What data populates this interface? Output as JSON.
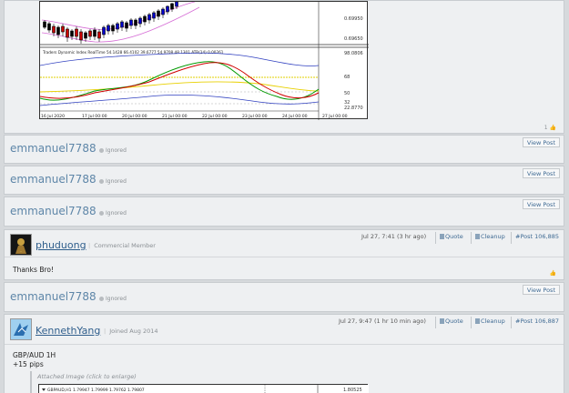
{
  "top_chart": {
    "indicator_header": "Traders Dynamic Index RealTime 54.1428 66.4102 39.6777 54.9708 48.1301  ATR(14) 0.00261",
    "price_ticks": [
      "0.69950",
      "0.69650"
    ],
    "indicator_ticks": [
      "98.0806",
      "68",
      "50",
      "32",
      "22.8770"
    ],
    "date_labels": [
      "16 Jul 2020",
      "17 Jul 00:00",
      "20 Jul 00:00",
      "21 Jul 00:00",
      "22 Jul 00:00",
      "23 Jul 00:00",
      "24 Jul 00:00",
      "27 Jul 00:00"
    ],
    "like_count": "1"
  },
  "ignored_posts": [
    {
      "username": "emmanuel7788",
      "status": "Ignored",
      "action": "View Post"
    },
    {
      "username": "emmanuel7788",
      "status": "Ignored",
      "action": "View Post"
    },
    {
      "username": "emmanuel7788",
      "status": "Ignored",
      "action": "View Post"
    },
    {
      "username": "emmanuel7788",
      "status": "Ignored",
      "action": "View Post"
    }
  ],
  "post_phuduong": {
    "username": "phuduong",
    "role": "Commercial Member",
    "timestamp": "Jul 27, 7:41 (3 hr ago)",
    "quote": "Quote",
    "cleanup": "Cleanup",
    "post_number": "Post 106,885",
    "body": "Thanks Bro!"
  },
  "post_kenneth": {
    "username": "KennethYang",
    "role": "Joined Aug 2014",
    "timestamp": "Jul 27, 9:47 (1 hr 10 min ago)",
    "quote": "Quote",
    "cleanup": "Cleanup",
    "post_number": "Post 106,887",
    "body_line1": "GBP/AUD 1H",
    "body_line2": "+15 pips",
    "attached_caption": "Attached Image (click to enlarge)",
    "chart_header": "GBPAUD,H1  1.79947 1.79999 1.79762 1.79807",
    "chart_price_tick": "1.80525"
  },
  "colors": {
    "username": "#5e86a8",
    "link": "#3f6a93",
    "panel_bg": "#eef0f2",
    "page_bg": "#d6d9dc"
  }
}
